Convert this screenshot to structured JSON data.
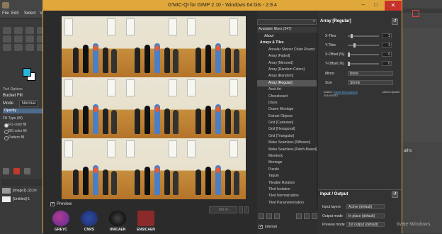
{
  "gimp": {
    "menu": [
      "File",
      "Edit",
      "Select",
      "View"
    ],
    "tool_options_tab": "Tool Options",
    "bucket_fill": "Bucket Fill",
    "mode_label": "Mode",
    "mode_value": "Normal",
    "opacity_label": "Opacity",
    "fill_type_label": "Fill Type (W)",
    "fill_options": [
      "FG color fill",
      "BG color fill",
      "Pattern fill"
    ],
    "layers": [
      "[image1] (2) [m",
      "[Untitled]-1"
    ],
    "right_text": "aths",
    "activate_windows": "tivate Windows."
  },
  "gmic": {
    "title": "G'MIC-Qt for GIMP 2.10 - Windows 64 bits - 2.9.4",
    "window_controls": [
      "–",
      "□",
      "✕"
    ],
    "preview_label": "Preview",
    "zoom_value": "143.%",
    "logos": [
      "GREYC",
      "CNRS",
      "UNICAEN",
      "ENSICAEN"
    ],
    "filters_header": "Available filters (547)",
    "filters": [
      {
        "label": "About",
        "kind": "collapsed"
      },
      {
        "label": "Arrays & Tiles",
        "kind": "category"
      },
      {
        "label": "Annular Steiner Chain Round",
        "kind": "item"
      },
      {
        "label": "Array [Faded]",
        "kind": "item"
      },
      {
        "label": "Array [Mirrored]",
        "kind": "item"
      },
      {
        "label": "Array [Random Colors]",
        "kind": "item"
      },
      {
        "label": "Array [Random]",
        "kind": "item"
      },
      {
        "label": "Array [Regular]",
        "kind": "selected"
      },
      {
        "label": "Ascii Art",
        "kind": "item"
      },
      {
        "label": "Chessboard",
        "kind": "item"
      },
      {
        "label": "Dices",
        "kind": "item"
      },
      {
        "label": "Drawn Montage",
        "kind": "item"
      },
      {
        "label": "Extract Objects",
        "kind": "item"
      },
      {
        "label": "Grid [Cartesian]",
        "kind": "item"
      },
      {
        "label": "Grid [Hexagonal]",
        "kind": "item"
      },
      {
        "label": "Grid [Triangular]",
        "kind": "item"
      },
      {
        "label": "Make Seamless [Diffusion]",
        "kind": "item"
      },
      {
        "label": "Make Seamless [Patch-Based]",
        "kind": "item"
      },
      {
        "label": "Mineteck",
        "kind": "item"
      },
      {
        "label": "Montage",
        "kind": "item"
      },
      {
        "label": "Puzzle",
        "kind": "item"
      },
      {
        "label": "Taquin",
        "kind": "item"
      },
      {
        "label": "Tileable Rotation",
        "kind": "item"
      },
      {
        "label": "Tiled Isolation",
        "kind": "item"
      },
      {
        "label": "Tiled Normalization",
        "kind": "item"
      },
      {
        "label": "Tiled Parameterization",
        "kind": "item"
      }
    ],
    "internet_label": "Internet",
    "params": {
      "title": "Array [Regular]",
      "x_tiles": {
        "label": "X-Tiles",
        "value": "2",
        "fraction": 0.1
      },
      "y_tiles": {
        "label": "Y-Tiles",
        "value": "3",
        "fraction": 0.2
      },
      "x_offset": {
        "label": "X-Offset (%)",
        "value": "0",
        "fraction": 0.0
      },
      "y_offset": {
        "label": "Y-Offset (%)",
        "value": "0",
        "fraction": 0.0
      },
      "mirror": {
        "label": "Mirror",
        "value": "None"
      },
      "size": {
        "label": "Size",
        "value": "Shrink"
      },
      "author_prefix": "Author:",
      "author_name": "David Tschumperlé",
      "latest_update_label": "Latest Update:",
      "latest_update": "2010/29/12"
    },
    "io": {
      "title": "Input / Output",
      "input_layers_label": "Input layers",
      "input_layers_value": "Active (default)",
      "output_mode_label": "Output mode",
      "output_mode_value": "In place (default)",
      "preview_mode_label": "Preview mode",
      "preview_mode_value": "1st output (default)"
    }
  }
}
